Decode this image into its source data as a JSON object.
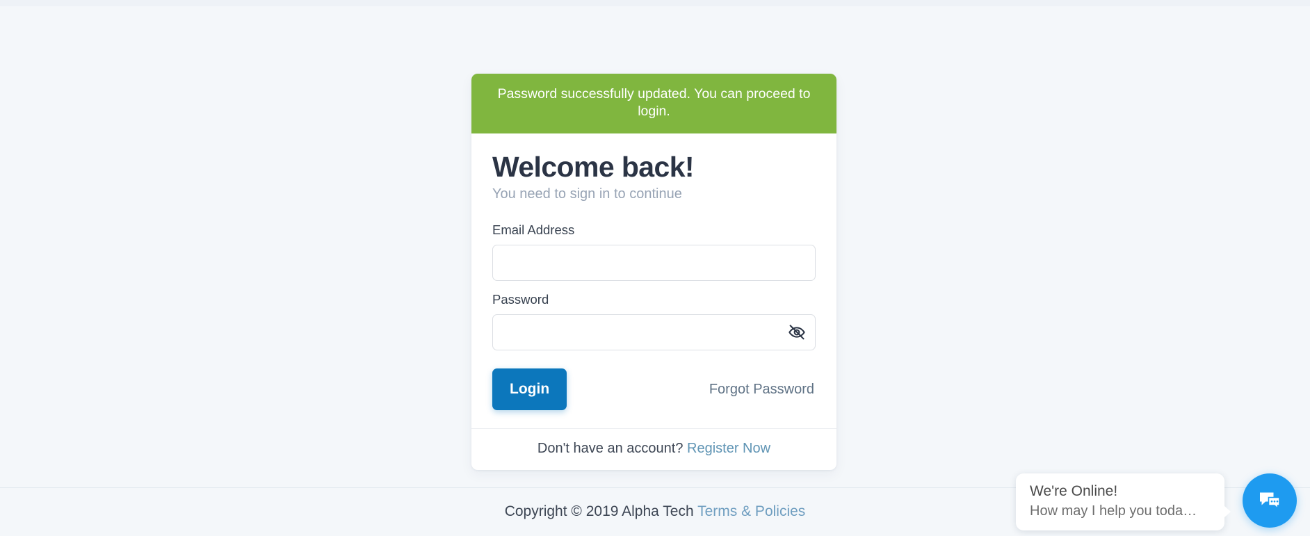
{
  "alert": {
    "message": "Password successfully updated. You can proceed to login.",
    "color": "#80b63f"
  },
  "card": {
    "title": "Welcome back!",
    "subtitle": "You need to sign in to continue",
    "email": {
      "label": "Email Address",
      "value": "",
      "placeholder": ""
    },
    "password": {
      "label": "Password",
      "value": "",
      "placeholder": "",
      "toggle_icon": "eye-off-icon"
    },
    "login_button": {
      "label": "Login",
      "color": "#0c77bc"
    },
    "forgot_link": "Forgot Password",
    "footer": {
      "prompt": "Don't have an account?",
      "register_link": "Register Now"
    }
  },
  "footer": {
    "copyright": "Copyright © 2019 Alpha Tech",
    "terms_link": "Terms & Policies"
  },
  "chat": {
    "title": "We're Online!",
    "subtitle": "How may I help you toda…",
    "button_icon": "chat-bubbles-icon",
    "button_color": "#1e9bf0"
  }
}
